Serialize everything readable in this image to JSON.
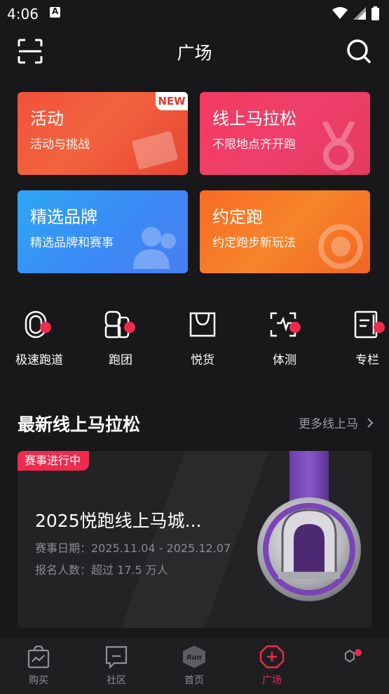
{
  "status_bar": {
    "time": "4:06"
  },
  "header": {
    "title": "广场"
  },
  "cards": [
    {
      "title": "活动",
      "subtitle": "活动与挑战",
      "badge": "NEW"
    },
    {
      "title": "线上马拉松",
      "subtitle": "不限地点齐开跑"
    },
    {
      "title": "精选品牌",
      "subtitle": "精选品牌和赛事"
    },
    {
      "title": "约定跑",
      "subtitle": "约定跑步新玩法"
    }
  ],
  "quick_icons": [
    {
      "label": "极速跑道",
      "icon": "track-icon"
    },
    {
      "label": "跑团",
      "icon": "team-icon"
    },
    {
      "label": "悦货",
      "icon": "shopping-bag-icon"
    },
    {
      "label": "体测",
      "icon": "body-test-icon"
    },
    {
      "label": "专栏",
      "icon": "column-icon"
    }
  ],
  "section": {
    "title": "最新线上马拉松",
    "more": "更多线上马"
  },
  "event": {
    "tag": "赛事进行中",
    "title": "2025悦跑线上马城...",
    "date": "赛事日期：2025.11.04 - 2025.12.07",
    "count": "报名人数：超过 17.5 万人"
  },
  "bottom_nav": [
    {
      "label": "购买",
      "active": false
    },
    {
      "label": "社区",
      "active": false
    },
    {
      "label": "首页",
      "active": false,
      "logo_text": "Run"
    },
    {
      "label": "广场",
      "active": true
    },
    {
      "label": "",
      "active": false
    }
  ],
  "colors": {
    "accent": "#ee2b4e",
    "background": "#18181b"
  }
}
